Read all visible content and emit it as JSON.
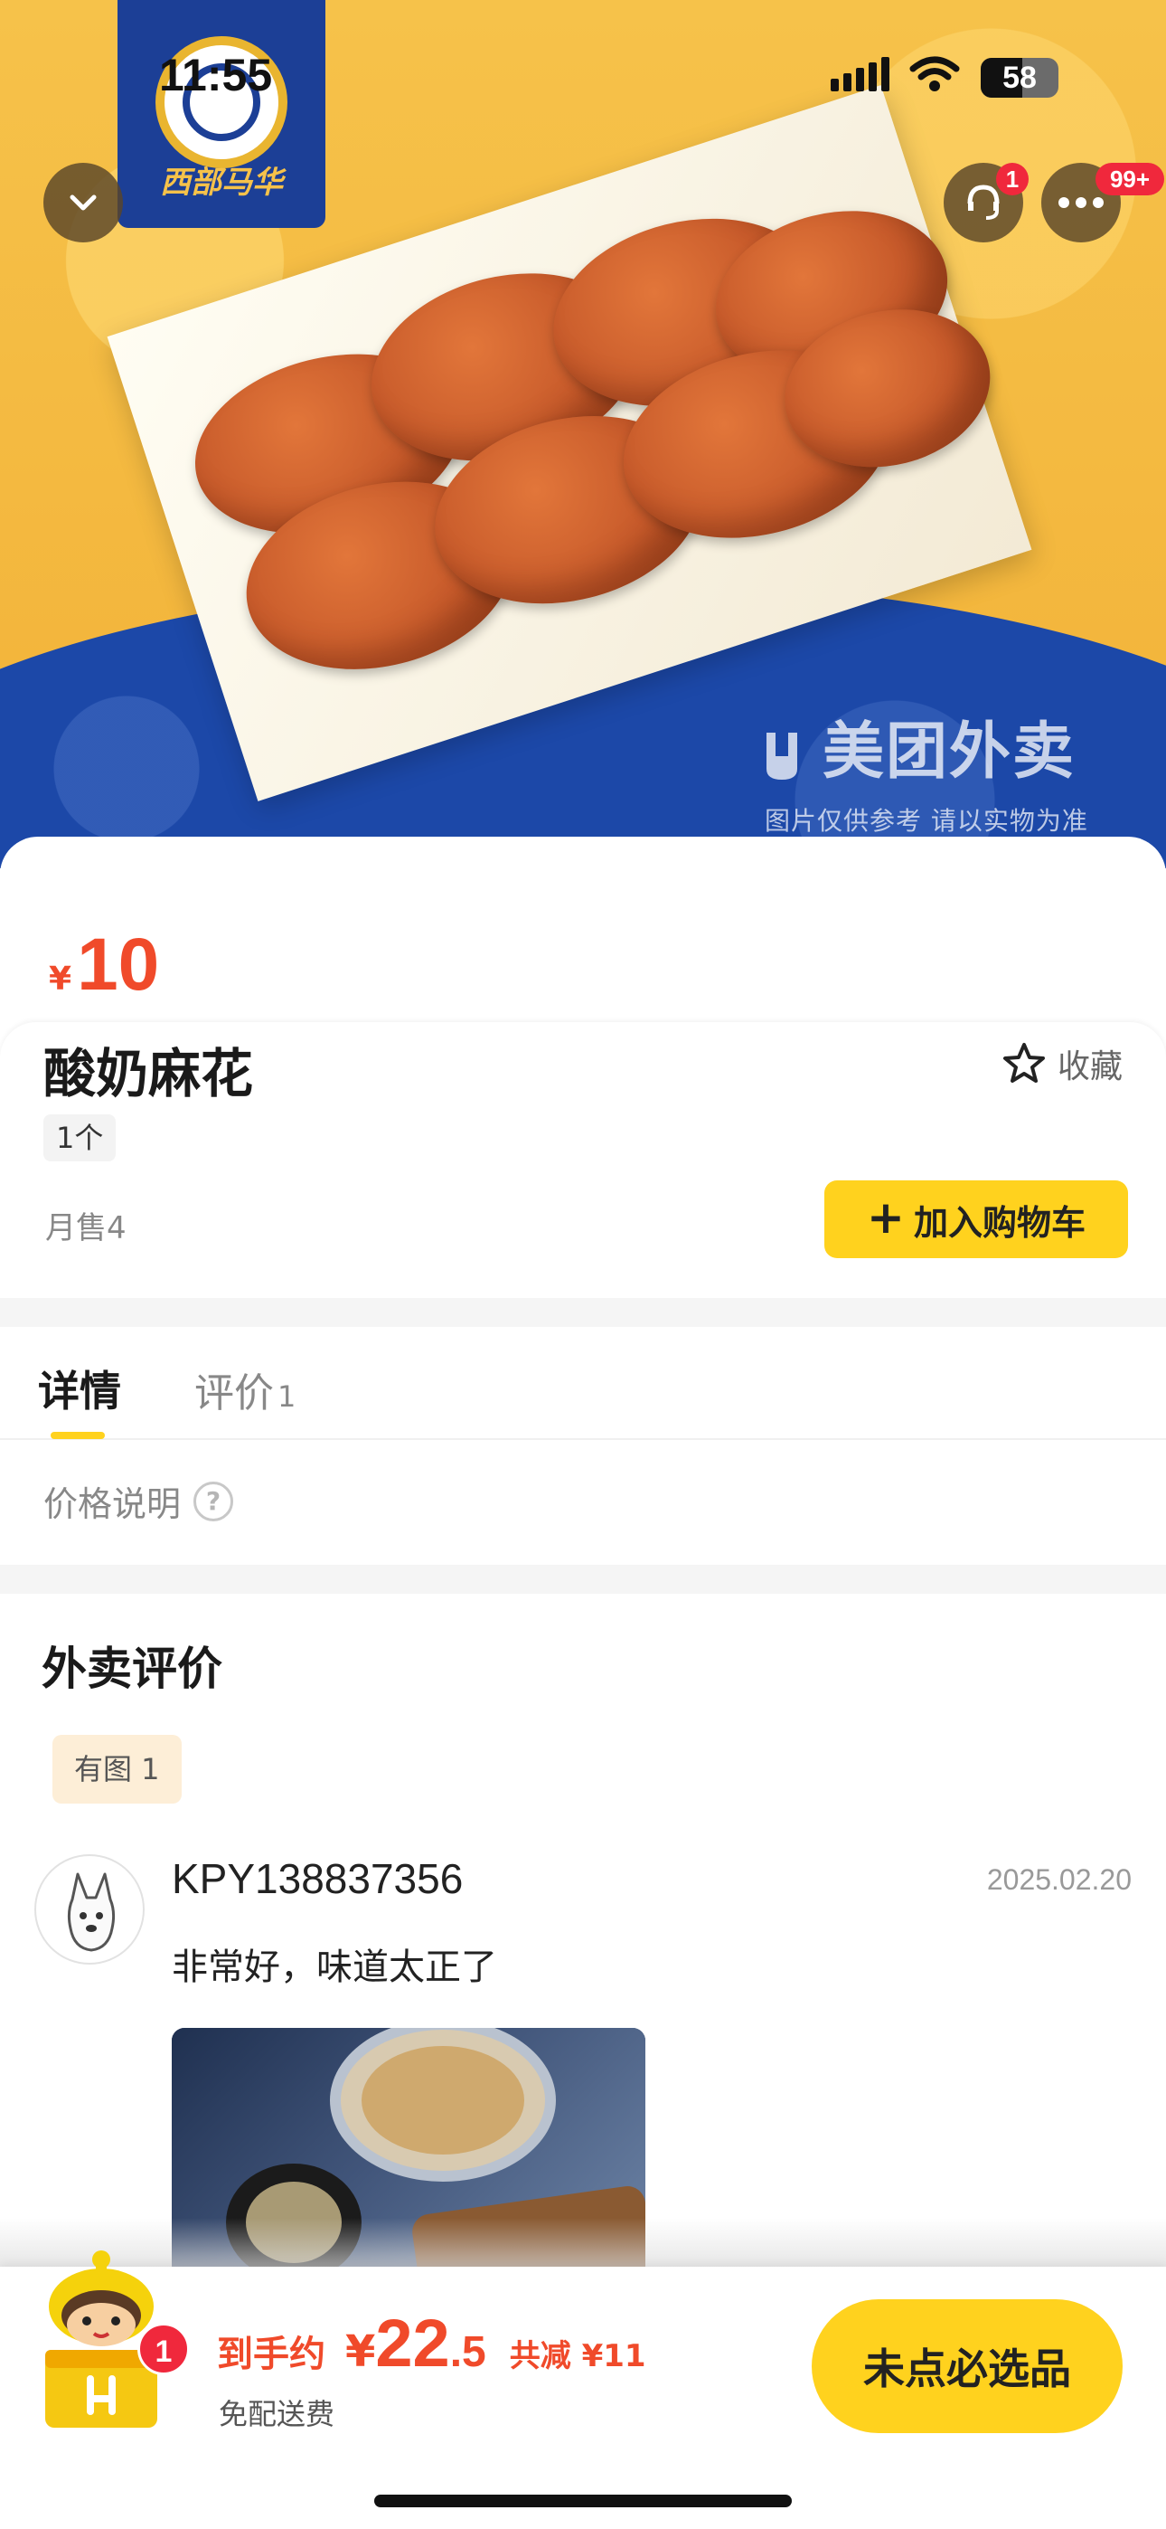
{
  "status_bar": {
    "time": "11:55",
    "battery": "58"
  },
  "hero": {
    "brand_sub": "西部马华",
    "watermark": "美团外卖",
    "watermark_note": "图片仅供参考 请以实物为准",
    "service_badge": "1",
    "more_badge": "99+"
  },
  "product": {
    "price_symbol": "¥",
    "price": "10",
    "name": "酸奶麻花",
    "favorite_label": "收藏",
    "unit": "1个",
    "monthly_sales": "月售4",
    "add_to_cart": "加入购物车"
  },
  "tabs": [
    {
      "label": "详情"
    },
    {
      "label": "评价",
      "count": "1"
    }
  ],
  "price_note": "价格说明",
  "reviews": {
    "heading": "外卖评价",
    "filter_chip": "有图 1",
    "items": [
      {
        "user": "KPY138837356",
        "date": "2025.02.20",
        "text": "非常好，味道太正了"
      }
    ]
  },
  "cart": {
    "count": "1",
    "label": "到手约",
    "yen": "¥",
    "total_int": "22",
    "total_dec": ".5",
    "savings": "共减 ¥11",
    "delivery": "免配送费",
    "checkout_label": "未点必选品"
  },
  "colors": {
    "accent_yellow": "#ffd21e",
    "price_red": "#f04a2a",
    "badge_red": "#f0283c",
    "brand_blue": "#1c48a8"
  },
  "icons": [
    "chevron-down-icon",
    "customer-service-icon",
    "more-icon",
    "star-icon",
    "plus-icon",
    "question-icon",
    "wifi-icon",
    "signal-icon",
    "battery-icon"
  ]
}
